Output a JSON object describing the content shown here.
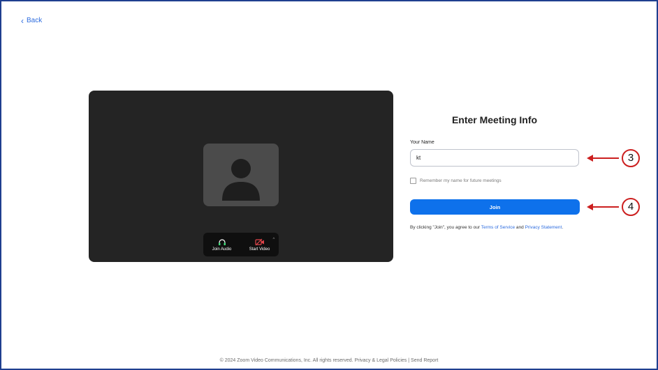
{
  "nav": {
    "back_label": "Back"
  },
  "preview": {
    "controls": [
      {
        "label": "Join Audio",
        "icon": "headphones-icon"
      },
      {
        "label": "Start Video",
        "icon": "video-off-icon"
      }
    ]
  },
  "form": {
    "title": "Enter Meeting Info",
    "name_label": "Your Name",
    "name_value": "kt",
    "remember_label": "Remember my name for future meetings",
    "join_label": "Join",
    "terms_prefix": "By clicking \"Join\", you agree to our ",
    "terms_link": "Terms of Service",
    "terms_mid": " and ",
    "privacy_link": "Privacy Statement",
    "terms_suffix": "."
  },
  "annotations": [
    {
      "number": "3"
    },
    {
      "number": "4"
    }
  ],
  "footer": {
    "copyright": "© 2024 Zoom Video Communications, Inc. All rights reserved.",
    "privacy_link": "Privacy & Legal Policies",
    "separator": "|",
    "report_link": "Send Report"
  },
  "colors": {
    "accent": "#0e71eb",
    "annotation_red": "#cc1f1f",
    "frame_border": "#1f3f8f",
    "preview_bg": "#242424"
  }
}
